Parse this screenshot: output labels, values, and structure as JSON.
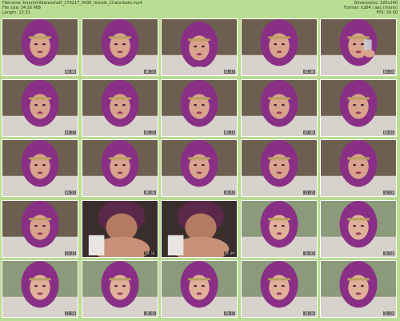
{
  "header": {
    "filename": "Filename: briarmhildaresshaft_170217_0436_female_Chaturbate.mp4",
    "filesize": "File size: 34.16 MiB",
    "length": "Length: 22:31",
    "dimensions": "Dimensions: 320x240",
    "format": "Format: h264 / aac (mono)",
    "fps": "FPS: 30.00"
  },
  "thumbnails": [
    {
      "time": "00:00",
      "scene": "face"
    },
    {
      "time": "00:53",
      "scene": "face"
    },
    {
      "time": "01:47",
      "scene": "face-down"
    },
    {
      "time": "02:40",
      "scene": "face"
    },
    {
      "time": "03:34",
      "scene": "drink"
    },
    {
      "time": "04:27",
      "scene": "face"
    },
    {
      "time": "05:21",
      "scene": "face"
    },
    {
      "time": "06:14",
      "scene": "face"
    },
    {
      "time": "07:08",
      "scene": "face"
    },
    {
      "time": "08:01",
      "scene": "face"
    },
    {
      "time": "08:55",
      "scene": "face"
    },
    {
      "time": "09:48",
      "scene": "face"
    },
    {
      "time": "10:42",
      "scene": "face"
    },
    {
      "time": "11:35",
      "scene": "face"
    },
    {
      "time": "12:29",
      "scene": "face"
    },
    {
      "time": "13:22",
      "scene": "face"
    },
    {
      "time": "14:16",
      "scene": "close-dark"
    },
    {
      "time": "15:09",
      "scene": "close-dark"
    },
    {
      "time": "16:03",
      "scene": "face-light"
    },
    {
      "time": "16:56",
      "scene": "face-light"
    },
    {
      "time": "17:50",
      "scene": "face-light"
    },
    {
      "time": "18:43",
      "scene": "face-light"
    },
    {
      "time": "19:37",
      "scene": "face-light"
    },
    {
      "time": "20:30",
      "scene": "face-light"
    },
    {
      "time": "21:24",
      "scene": "face-light"
    }
  ],
  "colors": {
    "background": "#b9dc93",
    "hair": "#8a2f86",
    "skin": "#d9a28c",
    "headband": "#b8a060",
    "wall": "#6d5f4f",
    "blanket": "#d8d2cc"
  }
}
